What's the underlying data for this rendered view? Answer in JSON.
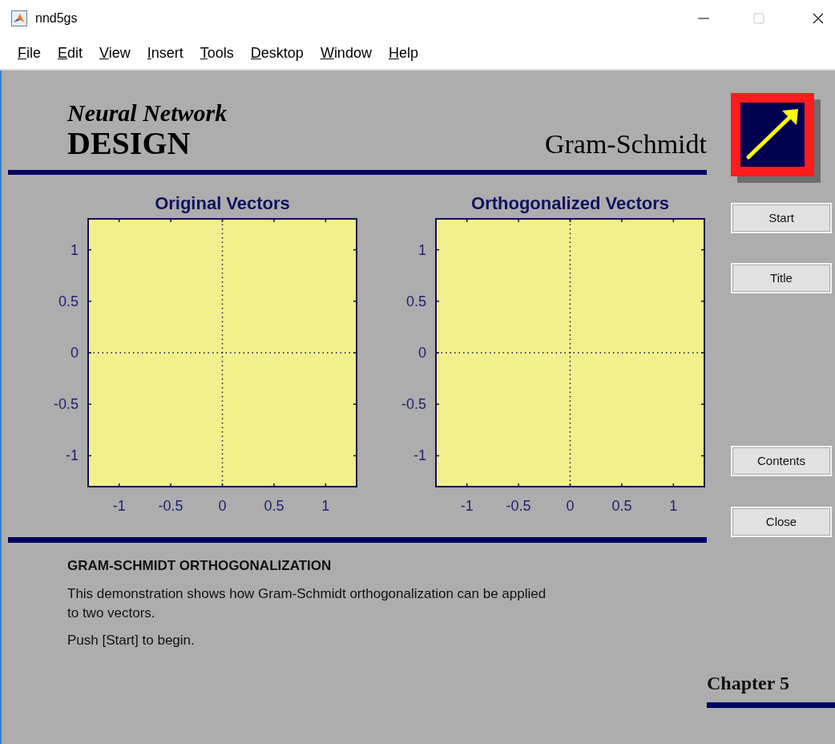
{
  "window": {
    "title": "nnd5gs"
  },
  "menu": [
    {
      "label": "File"
    },
    {
      "label": "Edit"
    },
    {
      "label": "View"
    },
    {
      "label": "Insert"
    },
    {
      "label": "Tools"
    },
    {
      "label": "Desktop"
    },
    {
      "label": "Window"
    },
    {
      "label": "Help"
    }
  ],
  "header": {
    "subtitle": "Neural Network",
    "title": "DESIGN",
    "demo_name": "Gram-Schmidt"
  },
  "plots": [
    {
      "chart_data": {
        "type": "line",
        "title": "Original Vectors",
        "xlim": [
          -1.3,
          1.3
        ],
        "ylim": [
          -1.3,
          1.3
        ],
        "xticks": [
          -1,
          -0.5,
          0,
          0.5,
          1
        ],
        "yticks": [
          -1,
          -0.5,
          0,
          0.5,
          1
        ]
      }
    },
    {
      "chart_data": {
        "type": "line",
        "title": "Orthogonalized Vectors",
        "xlim": [
          -1.3,
          1.3
        ],
        "ylim": [
          -1.3,
          1.3
        ],
        "xticks": [
          -1,
          -0.5,
          0,
          0.5,
          1
        ],
        "yticks": [
          -1,
          -0.5,
          0,
          0.5,
          1
        ]
      }
    }
  ],
  "buttons": [
    {
      "label": "Start"
    },
    {
      "label": "Title"
    },
    {
      "label": "Contents"
    },
    {
      "label": "Close"
    }
  ],
  "description": {
    "heading": "GRAM-SCHMIDT ORTHOGONALIZATION",
    "paragraphs": [
      "This demonstration shows how Gram-Schmidt orthogonalization can be applied to two vectors.",
      "Push [Start] to begin."
    ]
  },
  "chapter": "Chapter 5"
}
